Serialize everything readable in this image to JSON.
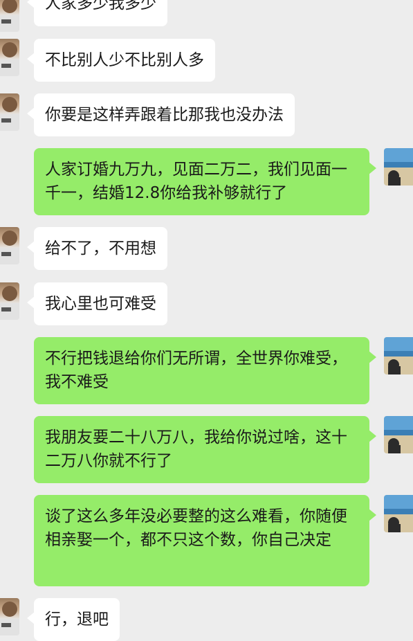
{
  "messages": [
    {
      "side": "left",
      "text": "人家多少我多少"
    },
    {
      "side": "left",
      "text": "不比别人少不比别人多"
    },
    {
      "side": "left",
      "text": "你要是这样弄跟着比那我也没办法"
    },
    {
      "side": "right",
      "text": "人家订婚九万九，见面二万二，我们见面一千一，结婚12.8你给我补够就行了"
    },
    {
      "side": "left",
      "text": "给不了，不用想"
    },
    {
      "side": "left",
      "text": "我心里也可难受"
    },
    {
      "side": "right",
      "text": "不行把钱退给你们无所谓，全世界你难受，我不难受"
    },
    {
      "side": "right",
      "text": "我朋友要二十八万八，我给你说过啥，这十二万八你就不行了"
    },
    {
      "side": "right",
      "text": "谈了这么多年没必要整的这么难看，你随便相亲娶一个，都不只这个数，你自己决定"
    },
    {
      "side": "left",
      "text": "行，退吧"
    }
  ],
  "colors": {
    "background": "#ededed",
    "bubble_incoming": "#ffffff",
    "bubble_outgoing": "#95ec69",
    "text": "#1a1a1a"
  },
  "icons": {
    "incoming_avatar": "person-avatar-icon",
    "outgoing_avatar": "beach-avatar-icon"
  }
}
